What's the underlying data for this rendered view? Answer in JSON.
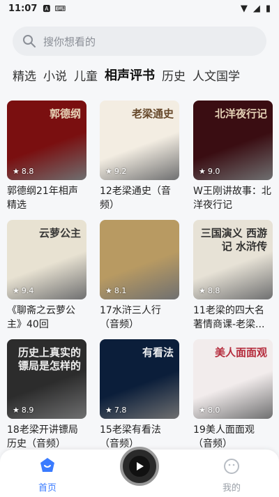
{
  "status": {
    "time": "11:07"
  },
  "search": {
    "placeholder": "搜你想看的"
  },
  "tabs": [
    "精选",
    "小说",
    "儿童",
    "相声评书",
    "历史",
    "人文国学"
  ],
  "active_tab_index": 3,
  "cards": [
    {
      "title": "郭德纲21年相声精选",
      "rating": "8.8",
      "cover_text": "郭德纲",
      "cover_bg": "#7a0f10",
      "cover_fg": "#f0e2c4"
    },
    {
      "title": "12老梁通史（音频）",
      "rating": "9.2",
      "cover_text": "老梁通史",
      "cover_bg": "#f3ede2",
      "cover_fg": "#5a3a1a"
    },
    {
      "title": "W王刚讲故事：北洋夜行记",
      "rating": "9.0",
      "cover_text": "北洋夜行记",
      "cover_bg": "#3a0d12",
      "cover_fg": "#f2e0c2"
    },
    {
      "title": "《聊斋之云萝公主》40回",
      "rating": "9.4",
      "cover_text": "云萝公主",
      "cover_bg": "#e8e2d2",
      "cover_fg": "#2a2a2a"
    },
    {
      "title": "17水浒三人行（音频）",
      "rating": "8.1",
      "cover_text": "",
      "cover_bg": "#b89a62",
      "cover_fg": "#3a2a12"
    },
    {
      "title": "11老梁的四大名著情商课-老梁...",
      "rating": "8.8",
      "cover_text": "三国演义 西游记 水浒传",
      "cover_bg": "#e7e2d6",
      "cover_fg": "#222"
    },
    {
      "title": "18老梁开讲镖局历史（音频）",
      "rating": "8.9",
      "cover_text": "历史上真实的镖局是怎样的",
      "cover_bg": "#2c2c2c",
      "cover_fg": "#ffffff"
    },
    {
      "title": "15老梁有看法（音频）",
      "rating": "7.8",
      "cover_text": "有看法",
      "cover_bg": "#0b1e3a",
      "cover_fg": "#ffffff"
    },
    {
      "title": "19美人面面观（音频）",
      "rating": "8.0",
      "cover_text": "美人面面观",
      "cover_bg": "#f2ecec",
      "cover_fg": "#b01c2e"
    }
  ],
  "nav": {
    "home": "首页",
    "me": "我的"
  },
  "colors": {
    "accent": "#3a7bff"
  }
}
